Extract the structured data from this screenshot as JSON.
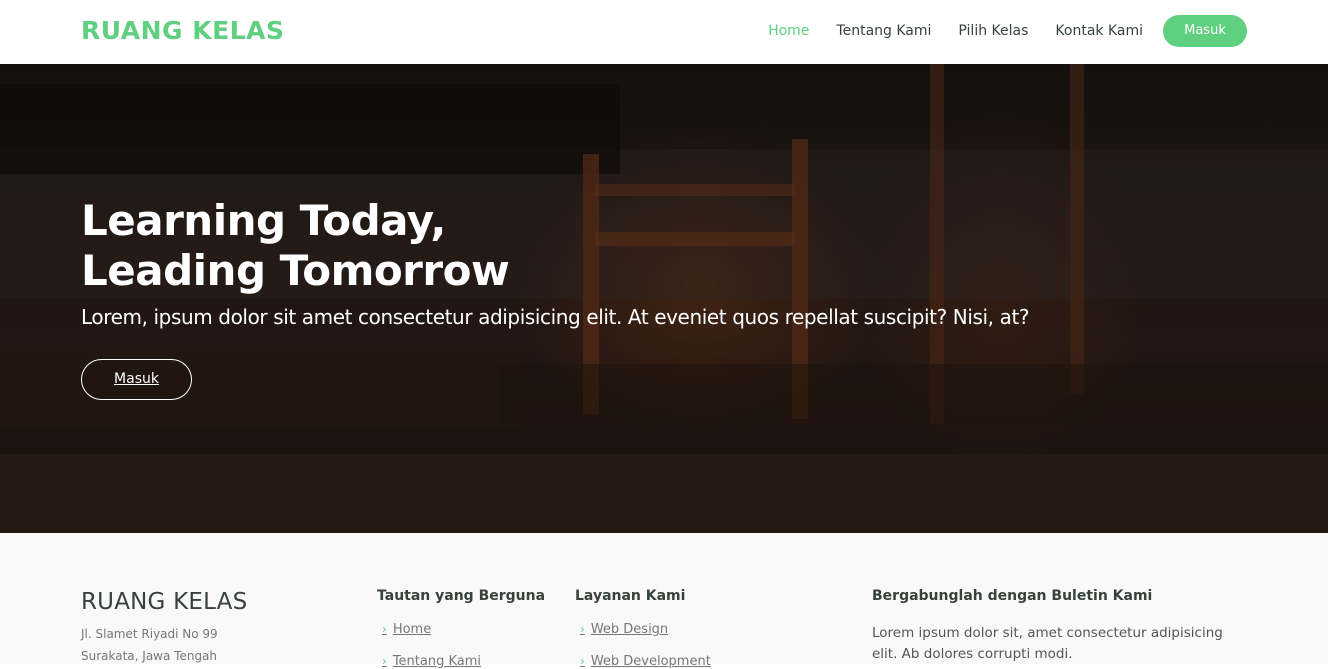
{
  "header": {
    "brand": "RUANG KELAS",
    "nav": [
      {
        "label": "Home",
        "active": true
      },
      {
        "label": "Tentang Kami",
        "active": false
      },
      {
        "label": "Pilih Kelas",
        "active": false
      },
      {
        "label": "Kontak Kami",
        "active": false
      }
    ],
    "login_button": "Masuk"
  },
  "hero": {
    "title_line1": "Learning Today,",
    "title_line2": "Leading Tomorrow",
    "subtitle": "Lorem, ipsum dolor sit amet consectetur adipisicing elit. At eveniet quos repellat suscipit? Nisi, at?",
    "cta": "Masuk"
  },
  "footer": {
    "brand": "RUANG KELAS",
    "address_line1": "Jl. Slamet Riyadi No 99",
    "address_line2": "Surakata, Jawa Tengah",
    "useful_links": {
      "title": "Tautan yang Berguna",
      "items": [
        "Home",
        "Tentang Kami"
      ]
    },
    "services": {
      "title": "Layanan Kami",
      "items": [
        "Web Design",
        "Web Development"
      ]
    },
    "newsletter": {
      "title": "Bergabunglah dengan Buletin Kami",
      "text": "Lorem ipsum dolor sit, amet consectetur adipisicing elit. Ab dolores corrupti modi."
    }
  },
  "colors": {
    "accent": "#5fcf80",
    "heading": "#37423b",
    "footer_bg": "#f9f9f9"
  }
}
